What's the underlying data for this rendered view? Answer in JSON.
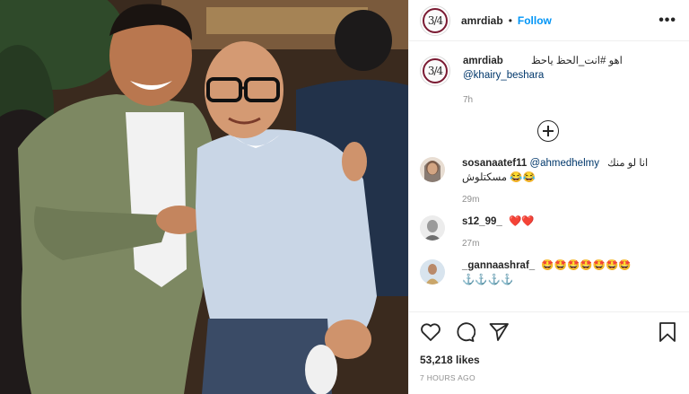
{
  "post": {
    "username": "amrdiab",
    "dot": "•",
    "follow_label": "Follow",
    "more_label": "•••",
    "avatar_text": "3/4"
  },
  "caption": {
    "username": "amrdiab",
    "text": "اهو #انت_الحظ ياحظ",
    "mention": "@khairy_besharа",
    "time": "7h"
  },
  "comments": [
    {
      "username": "sosanaatef11",
      "mention": "@ahmedhelmy",
      "text": "انا لو منك",
      "line2": "مسكتلوش 😂😂",
      "time": "29m"
    },
    {
      "username": "s12_99_",
      "text": "❤️❤️",
      "time": "27m"
    },
    {
      "username": "_gannaashraf_",
      "text": "🤩🤩🤩🤩🤩🤩🤩",
      "line2": "⚓⚓⚓⚓",
      "time": ""
    }
  ],
  "likes": "53,218 likes",
  "posted_ago": "7 HOURS AGO",
  "icons": [
    "heart-icon",
    "comment-icon",
    "share-icon",
    "bookmark-icon",
    "plus-circle-icon",
    "more-icon"
  ],
  "colors": {
    "accent": "#0095f6",
    "text": "#262626",
    "muted": "#8e8e8e",
    "heart": "#ed4956"
  }
}
